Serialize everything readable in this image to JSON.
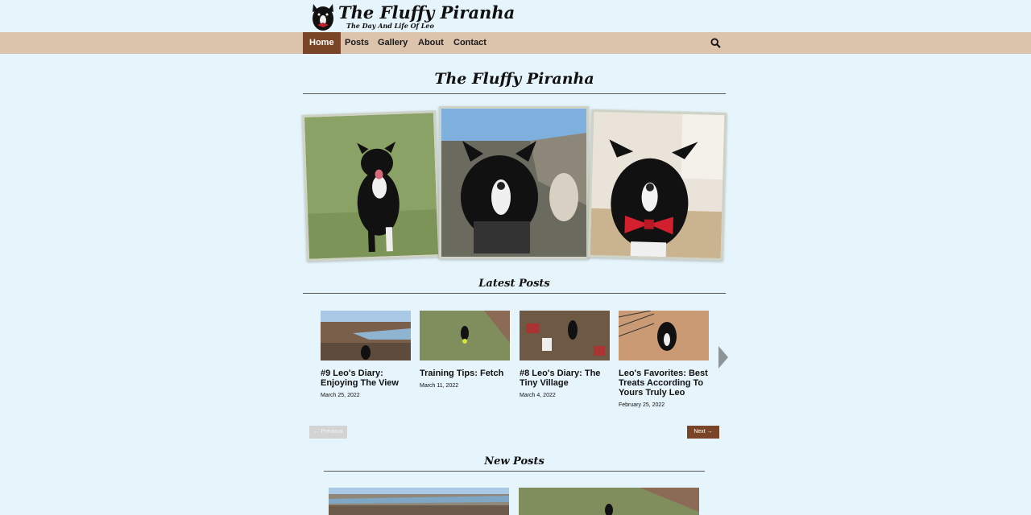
{
  "site": {
    "title": "The Fluffy Piranha",
    "tagline": "The Day And Life Of Leo"
  },
  "nav": {
    "items": [
      {
        "label": "Home",
        "active": true
      },
      {
        "label": "Posts"
      },
      {
        "label": "Gallery"
      },
      {
        "label": "About"
      },
      {
        "label": "Contact"
      }
    ],
    "search_icon": "search-icon"
  },
  "hero": {
    "title": "The Fluffy Piranha"
  },
  "latest": {
    "heading": "Latest Posts",
    "posts": [
      {
        "title": "#9 Leo's Diary: Enjoying The View",
        "date": "March 25, 2022"
      },
      {
        "title": "Training Tips: Fetch",
        "date": "March 11, 2022"
      },
      {
        "title": "#8 Leo's Diary: The Tiny Village",
        "date": "March 4, 2022"
      },
      {
        "title": "Leo's Favorites: Best Treats According To Yours Truly Leo",
        "date": "February 25, 2022"
      }
    ],
    "prev_label": "← Previous",
    "next_label": "Next →"
  },
  "new_posts": {
    "heading": "New Posts"
  },
  "colors": {
    "background": "#e6f4fb",
    "nav_bg": "#dcc3ac",
    "accent_brown": "#7a4426"
  }
}
